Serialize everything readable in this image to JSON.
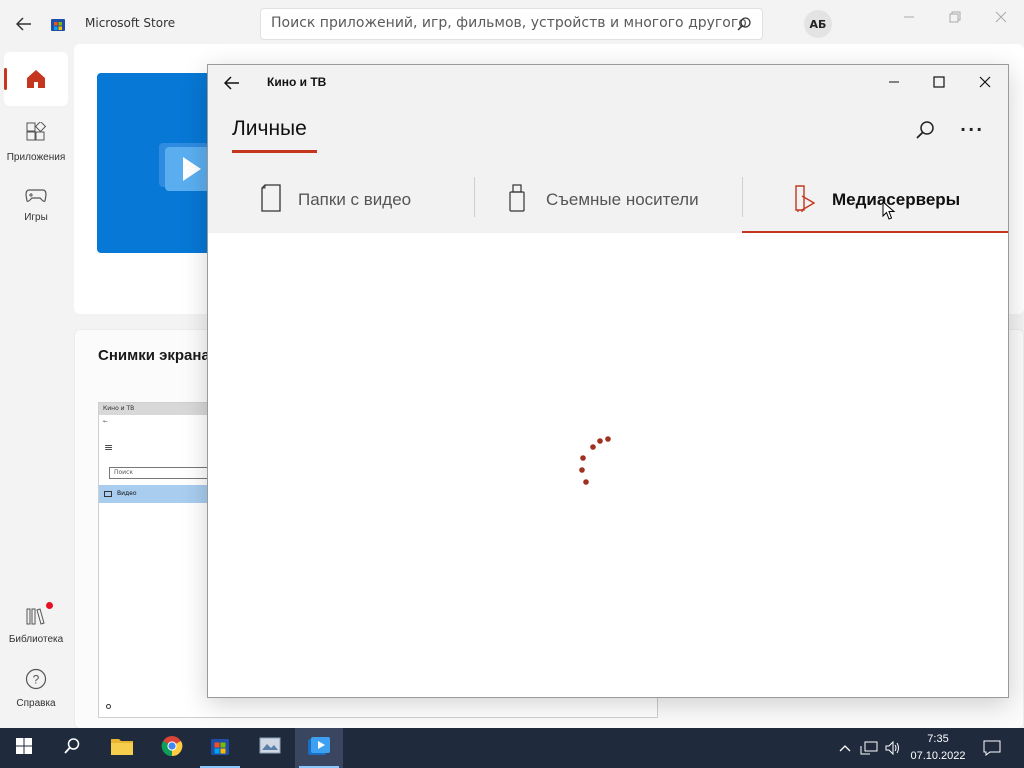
{
  "store": {
    "title": "Microsoft Store",
    "search_placeholder": "Поиск приложений, игр, фильмов, устройств и многого другого",
    "avatar_initials": "АБ",
    "nav": {
      "apps": "Приложения",
      "games": "Игры",
      "library": "Библиотека",
      "help": "Справка"
    },
    "screenshots_title": "Снимки экрана",
    "thumb": {
      "title": "Кино и ТВ",
      "search": "Поиск",
      "item": "Видео"
    }
  },
  "films": {
    "title": "Кино и ТВ",
    "heading": "Личные",
    "tabs": [
      {
        "label": "Папки с видео",
        "active": false
      },
      {
        "label": "Съемные носители",
        "active": false
      },
      {
        "label": "Медиасерверы",
        "active": true
      }
    ]
  },
  "taskbar": {
    "time": "7:35",
    "date": "07.10.2022"
  },
  "colors": {
    "accent": "#c4361e",
    "taskbar": "#1f2a3d",
    "store_blue": "#0778d5"
  }
}
